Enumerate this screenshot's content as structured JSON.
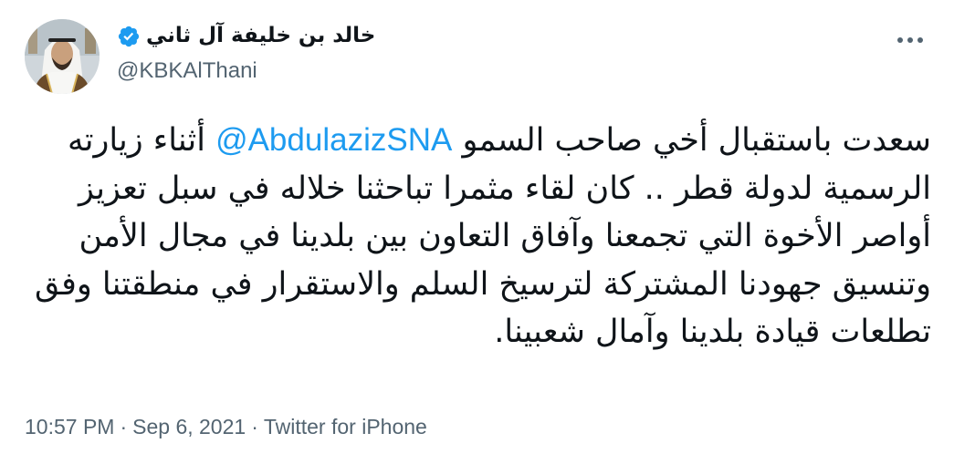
{
  "author": {
    "display_name": "خالد بن خليفة آل ثاني",
    "handle": "@KBKAlThani",
    "verified": true,
    "avatar_icon": "profile-photo",
    "verified_icon": "verified-badge-icon"
  },
  "tweet": {
    "text_before": "سعدت باستقبال أخي صاحب السمو ",
    "mention": "@AbdulazizSNA",
    "text_after": " أثناء زيارته الرسمية لدولة قطر .. كان لقاء مثمرا تباحثنا خلاله في سبل تعزيز أواصر الأخوة التي تجمعنا وآفاق التعاون بين بلدينا في مجال الأمن وتنسيق جهودنا المشتركة لترسيخ السلم والاستقرار في منطقتنا وفق تطلعات قيادة بلدينا وآمال شعبينا."
  },
  "meta": {
    "time": "10:57 PM",
    "separator": "·",
    "date": "Sep 6, 2021",
    "source": "Twitter for iPhone"
  },
  "colors": {
    "text": "#0f1419",
    "secondary": "#536471",
    "link": "#1d9bf0",
    "verified": "#1d9bf0"
  },
  "more_menu_icon": "more-horizontal-icon"
}
